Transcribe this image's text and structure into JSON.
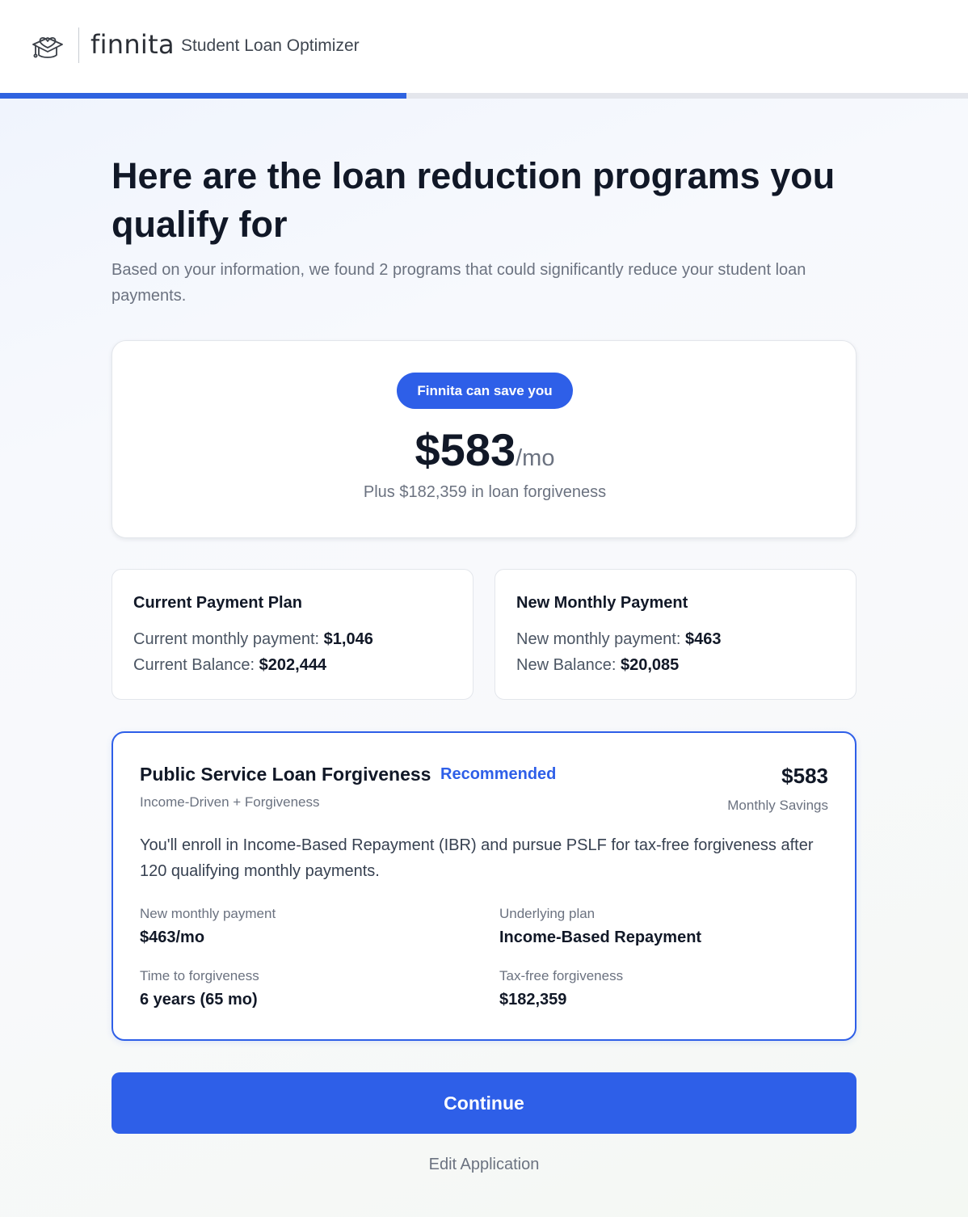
{
  "header": {
    "brand": "finnita",
    "app_name": "Student Loan Optimizer",
    "progress_percent": 42
  },
  "page": {
    "title": "Here are the loan reduction programs you qualify for",
    "subtitle": "Based on your information, we found 2 programs that could significantly reduce your student loan payments."
  },
  "savings": {
    "pill": "Finnita can save you",
    "amount": "$583",
    "unit": "/mo",
    "extra": "Plus $182,359 in loan forgiveness"
  },
  "current_plan": {
    "title": "Current Payment Plan",
    "payment_label": "Current monthly payment: ",
    "payment_value": "$1,046",
    "balance_label": "Current Balance: ",
    "balance_value": "$202,444"
  },
  "new_plan": {
    "title": "New Monthly Payment",
    "payment_label": "New monthly payment: ",
    "payment_value": "$463",
    "balance_label": "New Balance: ",
    "balance_value": "$20,085"
  },
  "program": {
    "name": "Public Service Loan Forgiveness",
    "badge": "Recommended",
    "type": "Income-Driven + Forgiveness",
    "savings": "$583",
    "savings_label": "Monthly Savings",
    "description": "You'll enroll in Income-Based Repayment (IBR) and pursue PSLF for tax-free forgiveness after 120 qualifying monthly payments.",
    "details": [
      {
        "label": "New monthly payment",
        "value": "$463/mo"
      },
      {
        "label": "Underlying plan",
        "value": "Income-Based Repayment"
      },
      {
        "label": "Time to forgiveness",
        "value": "6 years (65 mo)"
      },
      {
        "label": "Tax-free forgiveness",
        "value": "$182,359"
      }
    ]
  },
  "actions": {
    "continue": "Continue",
    "edit": "Edit Application"
  },
  "colors": {
    "accent": "#2e5fe8",
    "text": "#111827",
    "muted": "#6b7280"
  }
}
